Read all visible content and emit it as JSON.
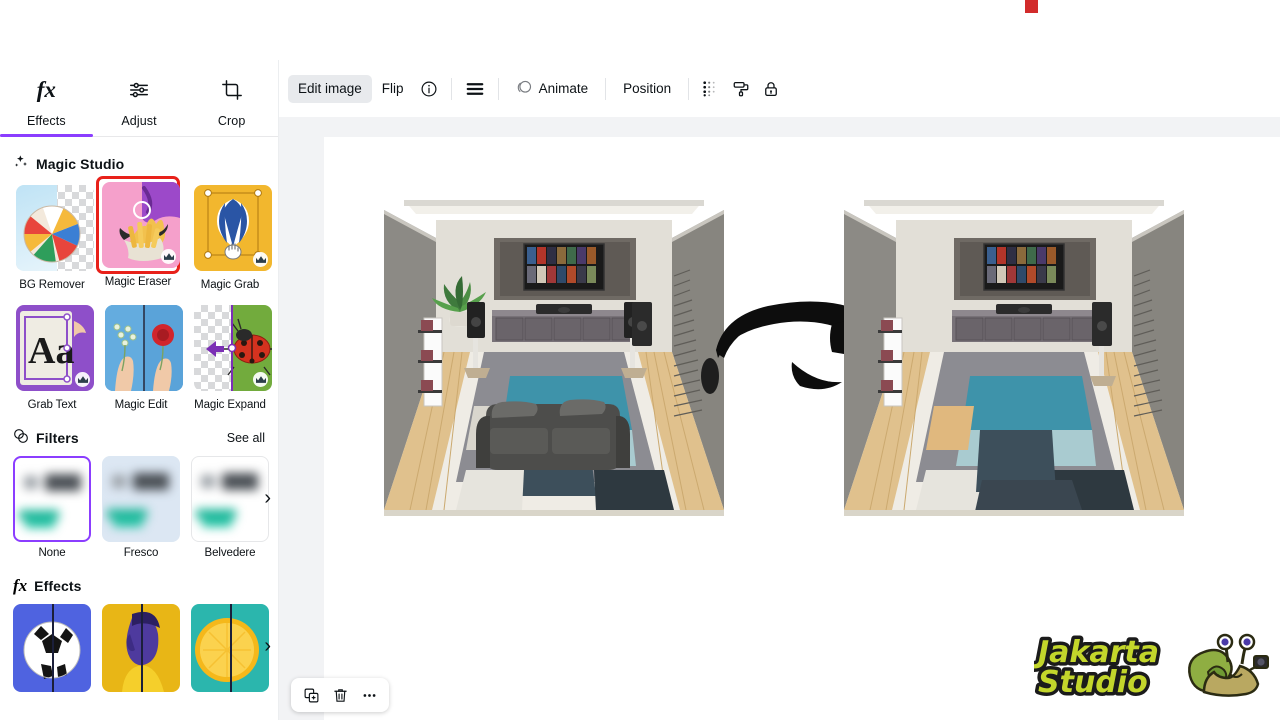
{
  "app": {
    "accent_purple": "#8b3dff",
    "selection_red": "#e8211a",
    "canvas_bg": "#f2f3f5"
  },
  "marker": {
    "name": "red-marker",
    "color": "#d22b2b"
  },
  "sidebar": {
    "tabs": [
      {
        "label": "Effects",
        "icon": "fx-icon",
        "active": true
      },
      {
        "label": "Adjust",
        "icon": "sliders-icon",
        "active": false
      },
      {
        "label": "Crop",
        "icon": "crop-icon",
        "active": false
      }
    ],
    "magic_studio": {
      "title": "Magic Studio",
      "icon": "sparkles-icon",
      "items": [
        {
          "label": "BG Remover",
          "premium": true,
          "selected": false
        },
        {
          "label": "Magic Eraser",
          "premium": true,
          "selected": true
        },
        {
          "label": "Magic Grab",
          "premium": true,
          "selected": false
        },
        {
          "label": "Grab Text",
          "premium": true,
          "selected": false
        },
        {
          "label": "Magic Edit",
          "premium": false,
          "selected": false
        },
        {
          "label": "Magic Expand",
          "premium": true,
          "selected": false
        }
      ]
    },
    "filters": {
      "title": "Filters",
      "icon": "filters-icon",
      "see_all": "See all",
      "next_icon": "chevron-right-icon",
      "items": [
        {
          "label": "None",
          "selected": true
        },
        {
          "label": "Fresco",
          "selected": false
        },
        {
          "label": "Belvedere",
          "selected": false
        }
      ]
    },
    "effects": {
      "title": "Effects",
      "icon": "fx-icon",
      "next_icon": "chevron-right-icon",
      "items": [
        {
          "label": "soccer-ball-effect"
        },
        {
          "label": "duotone-portrait-effect"
        },
        {
          "label": "orange-slice-effect"
        }
      ]
    }
  },
  "toolbar": {
    "edit_image": "Edit image",
    "flip": "Flip",
    "info_icon": "info-icon",
    "menu_icon": "hamburger-lines-icon",
    "animate": "Animate",
    "animate_icon": "animate-icon",
    "position": "Position",
    "transparency_icon": "transparency-icon",
    "paint_roller_icon": "paint-roller-icon",
    "lock_icon": "lock-icon"
  },
  "canvas": {
    "left_image_name": "room-before-render",
    "right_image_name": "room-after-render",
    "arrow_name": "transform-arrow",
    "watermark": {
      "line1": "Jakarta",
      "line2": "Studio",
      "mascot": "snail-mascot-icon",
      "text_color": "#c3d62b",
      "outline_color": "#1b1b1b"
    }
  },
  "float_toolbar": {
    "duplicate_icon": "duplicate-icon",
    "delete_icon": "trash-icon",
    "more_icon": "more-options-icon"
  }
}
